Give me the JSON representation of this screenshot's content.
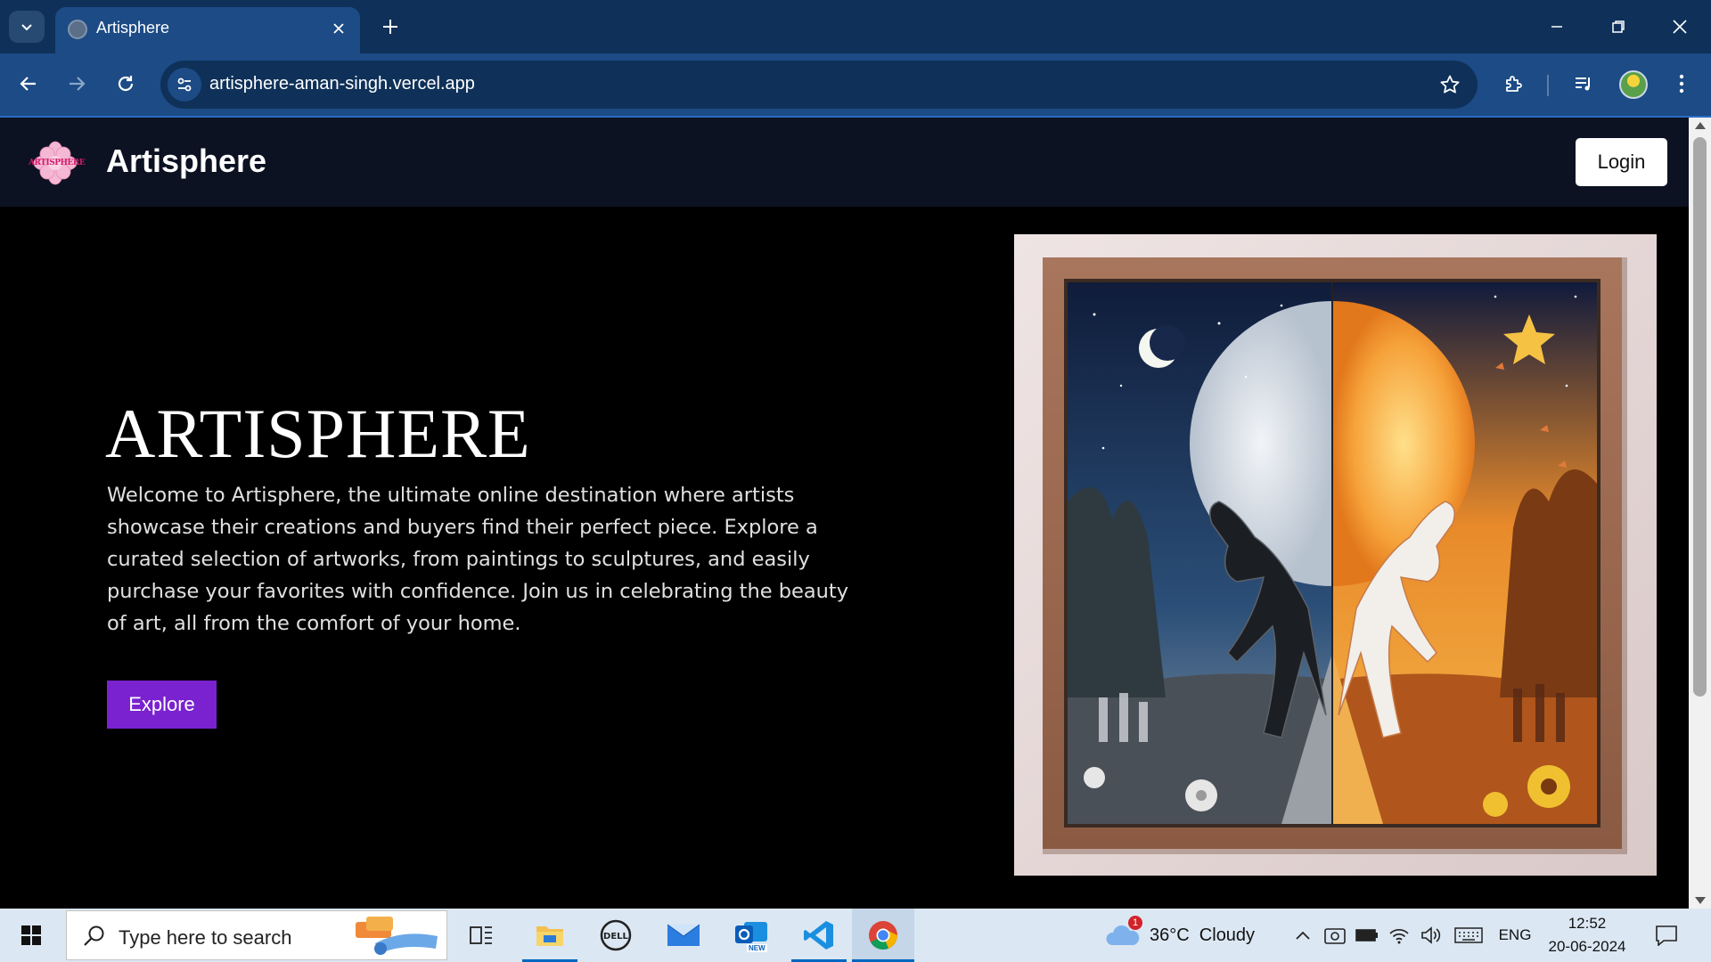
{
  "browser": {
    "tab_title": "Artisphere",
    "url": "artisphere-aman-singh.vercel.app"
  },
  "site": {
    "brand": "Artisphere",
    "logo_text": "ARTISPHERE",
    "login_label": "Login"
  },
  "hero": {
    "title": "ARTISPHERE",
    "description": "Welcome to Artisphere, the ultimate online destination where artists showcase their creations and buyers find their perfect piece. Explore a curated selection of artworks, from paintings to sculptures, and easily purchase your favorites with confidence. Join us in celebrating the beauty of art, all from the comfort of your home.",
    "explore_label": "Explore"
  },
  "taskbar": {
    "search_placeholder": "Type here to search",
    "weather": "36°C  Cloudy",
    "weather_badge": "1",
    "language": "ENG",
    "time": "12:52",
    "date": "20-06-2024",
    "outlook_badge": "NEW"
  },
  "colors": {
    "accent": "#7a22cf",
    "chrome": "#1c4b86",
    "header": "#0c1222"
  }
}
